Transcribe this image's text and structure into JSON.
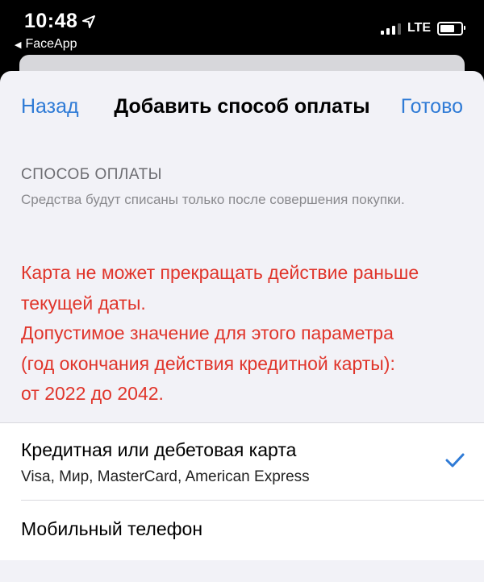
{
  "status_bar": {
    "time": "10:48",
    "location_icon": "location-arrow-icon",
    "back_app": "FaceApp",
    "network": "LTE"
  },
  "nav": {
    "back_label": "Назад",
    "title": "Добавить способ оплаты",
    "done_label": "Готово"
  },
  "section": {
    "header": "СПОСОБ ОПЛАТЫ",
    "subtitle": "Средства будут списаны только после совершения покупки."
  },
  "error": {
    "lines": [
      "Карта не может прекращать действие раньше",
      "текущей даты.",
      "Допустимое значение для этого параметра",
      "(год окончания действия кредитной карты):",
      "от 2022 до 2042."
    ],
    "color": "#e0352b"
  },
  "payment_options": [
    {
      "label": "Кредитная или дебетовая карта",
      "sublabel": "Visa, Мир, MasterCard, American Express",
      "selected": true
    },
    {
      "label": "Мобильный телефон",
      "selected": false
    }
  ],
  "colors": {
    "accent": "#2f7bd6",
    "background": "#f2f2f7",
    "error": "#e0352b"
  }
}
